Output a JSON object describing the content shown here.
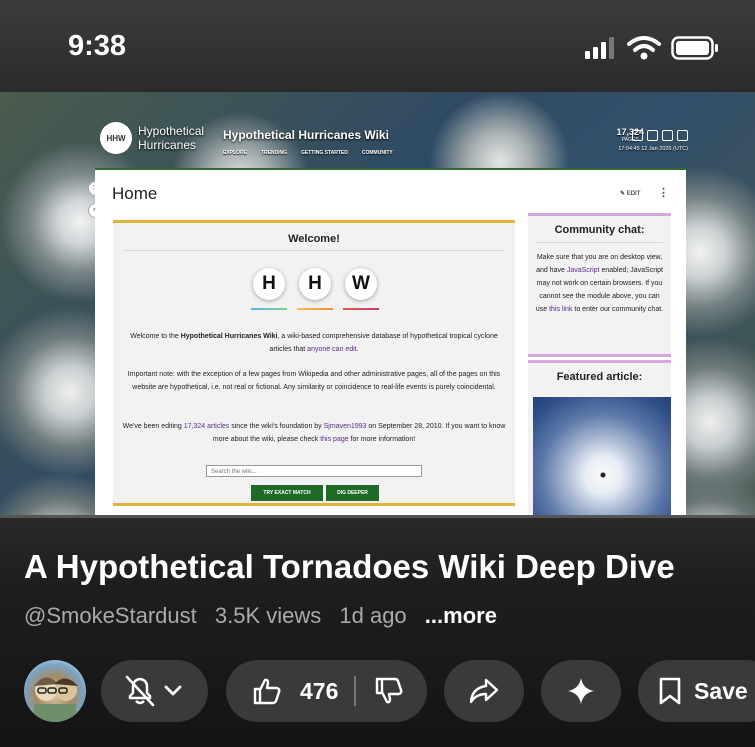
{
  "status_bar": {
    "time": "9:38"
  },
  "wiki": {
    "logo_text_line1": "Hypothetical",
    "logo_text_line2": "Hurricanes",
    "logo_mark": "HHW",
    "site_title": "Hypothetical Hurricanes Wiki",
    "nav": [
      "EXPLORE",
      "TRENDING",
      "GETTING STARTED",
      "COMMUNITY"
    ],
    "page_count": "17,324",
    "page_count_label": "PAGES",
    "timestamp": "17:04:45 12 Jan 2026 (UTC)",
    "page_title": "Home",
    "edit_label": "EDIT",
    "welcome": {
      "title": "Welcome!",
      "logo_letters": [
        "H",
        "H",
        "W"
      ],
      "p1_pre": "Welcome to the ",
      "p1_bold": "Hypothetical Hurricanes Wiki",
      "p1_mid": ", a wiki-based comprehensive database of hypothetical tropical cyclone articles that ",
      "p1_link": "anyone can edit",
      "p1_post": ".",
      "p2": "Important note: with the exception of a few pages from Wikipedia and other administrative pages, all of the pages on this website are hypothetical, i.e. not real or fictional. Any similarity or coincidence to real-life events is purely coincidental.",
      "p3_pre": "We've been editing ",
      "p3_link1": "17,324 articles",
      "p3_mid": " since the wiki's foundation by ",
      "p3_link2": "Sjmaven1993",
      "p3_mid2": " on September 28, 2010. If you want to know more about the wiki, please check ",
      "p3_link3": "this page",
      "p3_post": " for more information!",
      "search_placeholder": "Search the wiki...",
      "btn_exact": "TRY EXACT MATCH",
      "btn_deeper": "DIG DEEPER"
    },
    "community_chat": {
      "title": "Community chat:",
      "text_pre": "Make sure that you are on desktop view, and have ",
      "text_link1": "JavaScript",
      "text_mid": " enabled; JavaScript may not work on certain browsers. If you cannot see the module above, you can use ",
      "text_link2": "this link",
      "text_post": " to enter our community chat."
    },
    "featured": {
      "title": "Featured article:"
    }
  },
  "video": {
    "title": "A Hypothetical Tornadoes Wiki Deep Dive",
    "channel": "@SmokeStardust",
    "views": "3.5K views",
    "age": "1d ago",
    "more": "...more"
  },
  "actions": {
    "likes": "476",
    "save_label": "Save"
  },
  "colors": {
    "accent_green": "#1f6b26",
    "link_purple": "#5a2a8c",
    "gold": "#e3b43c"
  }
}
